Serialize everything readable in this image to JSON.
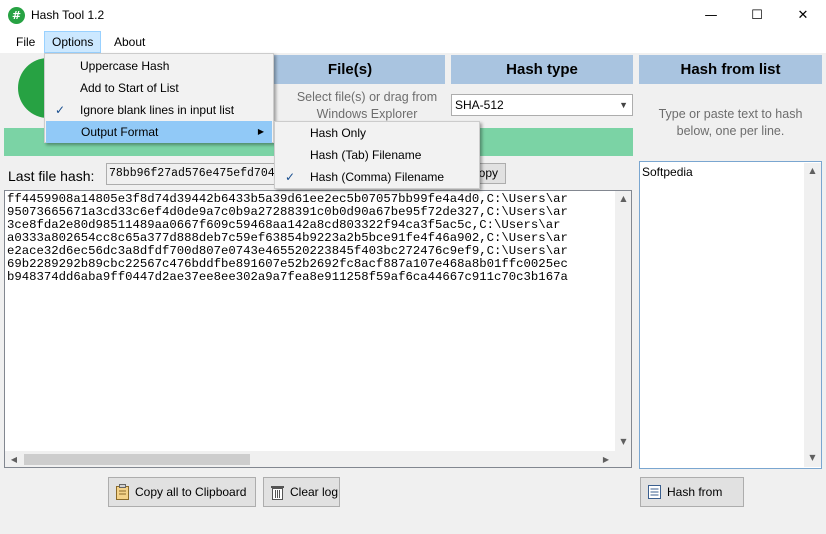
{
  "window": {
    "title": "Hash Tool 1.2",
    "minimize": "—",
    "maximize": "☐",
    "close": "✕",
    "app_icon": "#"
  },
  "menubar": {
    "file": "File",
    "options": "Options",
    "about": "About"
  },
  "options_menu": {
    "items": [
      {
        "label": "Uppercase Hash",
        "checked": false
      },
      {
        "label": "Add to Start of List",
        "checked": false
      },
      {
        "label": "Ignore blank lines in input list",
        "checked": true
      },
      {
        "label": "Output Format",
        "has_submenu": true,
        "highlighted": true
      }
    ]
  },
  "output_format_submenu": {
    "items": [
      {
        "label": "Hash Only",
        "checked": false
      },
      {
        "label": "Hash (Tab) Filename",
        "checked": false
      },
      {
        "label": "Hash (Comma) Filename",
        "checked": true
      }
    ]
  },
  "file_panel": {
    "header": "File(s)",
    "hint_line1": "Select file(s) or drag from",
    "hint_line2": "Windows Explorer"
  },
  "hash_type_panel": {
    "header": "Hash type",
    "selected": "SHA-512"
  },
  "list_panel": {
    "header": "Hash from list",
    "hint_line1": "Type or paste text to hash",
    "hint_line2": "below, one per line.",
    "text": "Softpedia",
    "button": "Hash from List"
  },
  "last_hash": {
    "label": "Last file hash:",
    "value": "78bb96f27ad576e475efd704a",
    "copy_button": "Copy"
  },
  "log": {
    "lines": [
      "ff4459908a14805e3f8d74d39442b6433b5a39d61ee2ec5b07057bb99fe4a4d0,C:\\Users\\ar",
      "95073665671a3cd33c6ef4d0de9a7c0b9a27288391c0b0d90a67be95f72de327,C:\\Users\\ar",
      "3ce8fda2e80d98511489aa0667f609c59468aa142a8cd803322f94ca3f5ac5c,C:\\Users\\ar",
      "a0333a802654cc8c65a377d888deb7c59ef63854b9223a2b5bce91fe4f46a902,C:\\Users\\ar",
      "e2ace32d6ec56dc3a8dfdf700d807e0743e465520223845f403bc272476c9ef9,C:\\Users\\ar",
      "69b2289292b89cbc22567c476bddfbe891607e52b2692fc8acf887a107e468a8b01ffc0025ec",
      "b948374dd6aba9ff0447d2ae37ee8ee302a9a7fea8e911258f59af6ca44667c911c70c3b167a"
    ]
  },
  "buttons": {
    "copy_all": "Copy all to Clipboard",
    "clear_log": "Clear log"
  },
  "colors": {
    "header_bg": "#a9c4e0",
    "progress_bar": "#7bd3a5",
    "menu_highlight": "#91c9f7",
    "app_green": "#27a243"
  },
  "icons": {
    "check": "✓",
    "submenu_arrow": "▶",
    "dropdown_arrow": "▼",
    "scroll_up": "▲",
    "scroll_down": "▼",
    "scroll_left": "◀",
    "scroll_right": "▶"
  }
}
